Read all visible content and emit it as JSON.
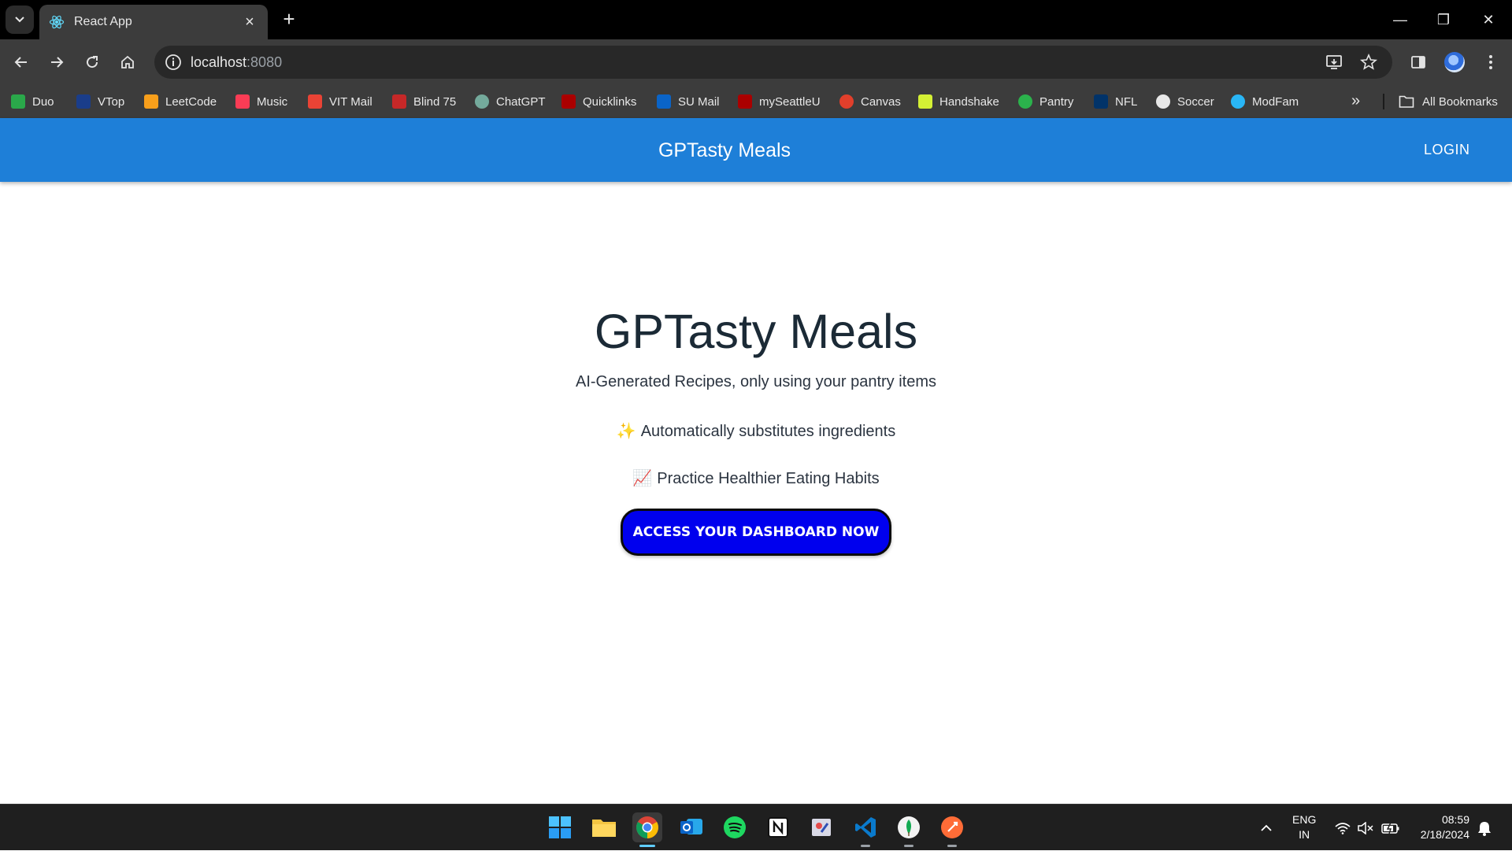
{
  "browser": {
    "tab_title": "React App",
    "url_host": "localhost",
    "url_port": ":8080"
  },
  "bookmarks": [
    {
      "label": "Duo",
      "icon": "duo-icon",
      "color": "#2aa84a"
    },
    {
      "label": "VTop",
      "icon": "vtop-icon",
      "color": "#1a3d8a"
    },
    {
      "label": "LeetCode",
      "icon": "leetcode-icon",
      "color": "#f89f1b"
    },
    {
      "label": "Music",
      "icon": "music-icon",
      "color": "#fa3c55"
    },
    {
      "label": "VIT Mail",
      "icon": "gmail-icon",
      "color": "#ea4335"
    },
    {
      "label": "Blind 75",
      "icon": "blind-icon",
      "color": "#c62828"
    },
    {
      "label": "ChatGPT",
      "icon": "chatgpt-icon",
      "color": "#74aa9c"
    },
    {
      "label": "Quicklinks",
      "icon": "seattleu-icon",
      "color": "#aa0000"
    },
    {
      "label": "SU Mail",
      "icon": "outlook-icon",
      "color": "#0a64c8"
    },
    {
      "label": "mySeattleU",
      "icon": "seattleu-icon",
      "color": "#aa0000"
    },
    {
      "label": "Canvas",
      "icon": "canvas-icon",
      "color": "#e13f2b"
    },
    {
      "label": "Handshake",
      "icon": "handshake-icon",
      "color": "#d4f034"
    },
    {
      "label": "Pantry",
      "icon": "pantry-icon",
      "color": "#2bb24c"
    },
    {
      "label": "NFL",
      "icon": "nfl-icon",
      "color": "#013369"
    },
    {
      "label": "Soccer",
      "icon": "soccer-icon",
      "color": "#e8e8e8"
    },
    {
      "label": "ModFam",
      "icon": "modfam-icon",
      "color": "#29b6f6"
    }
  ],
  "all_bookmarks_label": "All Bookmarks",
  "appbar": {
    "title": "GPTasty Meals",
    "login_label": "LOGIN"
  },
  "hero": {
    "title": "GPTasty Meals",
    "subtitle": "AI-Generated Recipes, only using your pantry items",
    "features": [
      {
        "emoji": "✨",
        "text": "Automatically substitutes ingredients"
      },
      {
        "emoji": "📈",
        "text": "Practice Healthier Eating Habits"
      }
    ],
    "cta_label": "ACCESS YOUR DASHBOARD NOW"
  },
  "taskbar": {
    "lang_line1": "ENG",
    "lang_line2": "IN",
    "time": "08:59",
    "date": "2/18/2024"
  },
  "colors": {
    "appbar": "#1e7fd8",
    "cta": "#0000ee"
  }
}
